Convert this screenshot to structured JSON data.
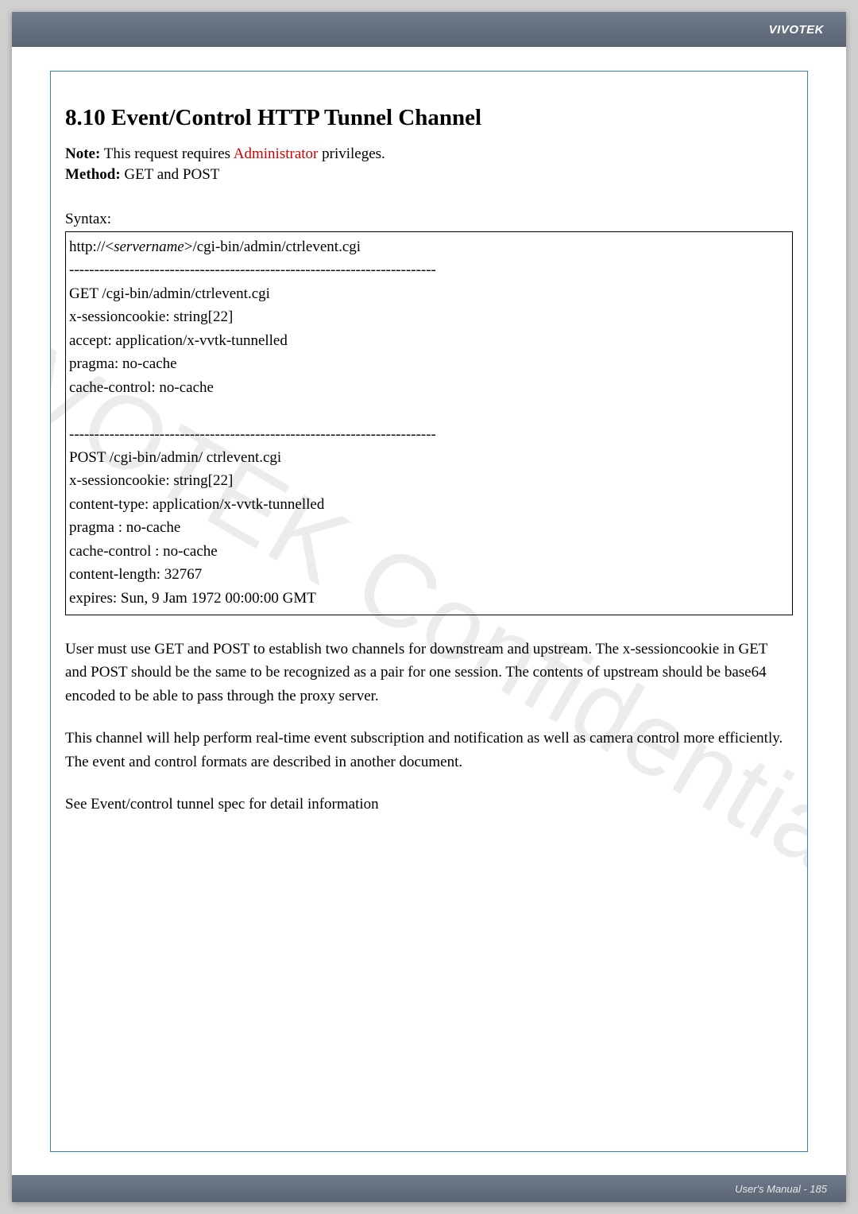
{
  "brand": "VIVOTEK",
  "section_title": "8.10 Event/Control HTTP Tunnel Channel",
  "note_label": "Note:",
  "note_text_before": " This request requires ",
  "note_admin": "Administrator",
  "note_text_after": " privileges.",
  "method_label": "Method:",
  "method_value": " GET and POST",
  "syntax_label": "Syntax:",
  "syntax_url_prefix": "http://<",
  "syntax_url_server": "servername",
  "syntax_url_suffix": ">/cgi-bin/admin/ctrlevent.cgi",
  "dashes": "-------------------------------------------------------------------------",
  "get_block": {
    "l1": "GET /cgi-bin/admin/ctrlevent.cgi",
    "l2": "x-sessioncookie: string[22]",
    "l3": "accept: application/x-vvtk-tunnelled",
    "l4": "pragma: no-cache",
    "l5": "cache-control: no-cache"
  },
  "post_block": {
    "l1": "POST /cgi-bin/admin/ ctrlevent.cgi",
    "l2": "x-sessioncookie: string[22]",
    "l3": "content-type: application/x-vvtk-tunnelled",
    "l4": "pragma : no-cache",
    "l5": "cache-control : no-cache",
    "l6": "content-length: 32767",
    "l7": "expires: Sun, 9 Jam 1972 00:00:00 GMT"
  },
  "para1": "User must use GET and POST to establish two channels for downstream and upstream. The x-sessioncookie in GET and POST should be the same to be recognized as a pair for one session. The contents of upstream should be base64 encoded to be able to pass through the proxy server.",
  "para2": "This channel will help perform real-time event subscription and notification as well as camera control more efficiently. The event and control formats are described in another document.",
  "para3": "See Event/control tunnel spec for detail information",
  "watermark": "VIVOTEK Confidential",
  "footer": "User's Manual - 185"
}
